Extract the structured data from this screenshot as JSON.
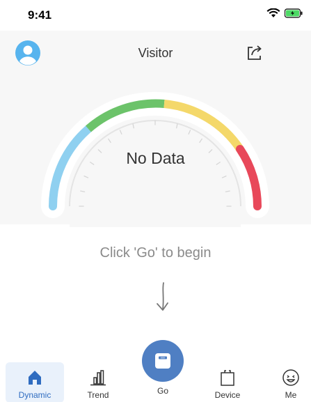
{
  "status_bar": {
    "time": "9:41"
  },
  "header": {
    "title": "Visitor"
  },
  "gauge": {
    "text": "No Data",
    "min_mark": "–",
    "max_mark": "–"
  },
  "prompt": "Click 'Go' to begin",
  "tabs": [
    {
      "label": "Dynamic",
      "icon": "home-icon",
      "active": true
    },
    {
      "label": "Trend",
      "icon": "bar-chart-icon",
      "active": false
    },
    {
      "label": "Go",
      "icon": "scale-icon",
      "active": false
    },
    {
      "label": "Device",
      "icon": "bag-icon",
      "active": false
    },
    {
      "label": "Me",
      "icon": "smiley-icon",
      "active": false
    }
  ],
  "colors": {
    "accent": "#4f7fc3",
    "gauge_blue": "#8fd0f0",
    "gauge_green": "#6cc36a",
    "gauge_yellow": "#f4d86a",
    "gauge_red": "#e8485a"
  }
}
